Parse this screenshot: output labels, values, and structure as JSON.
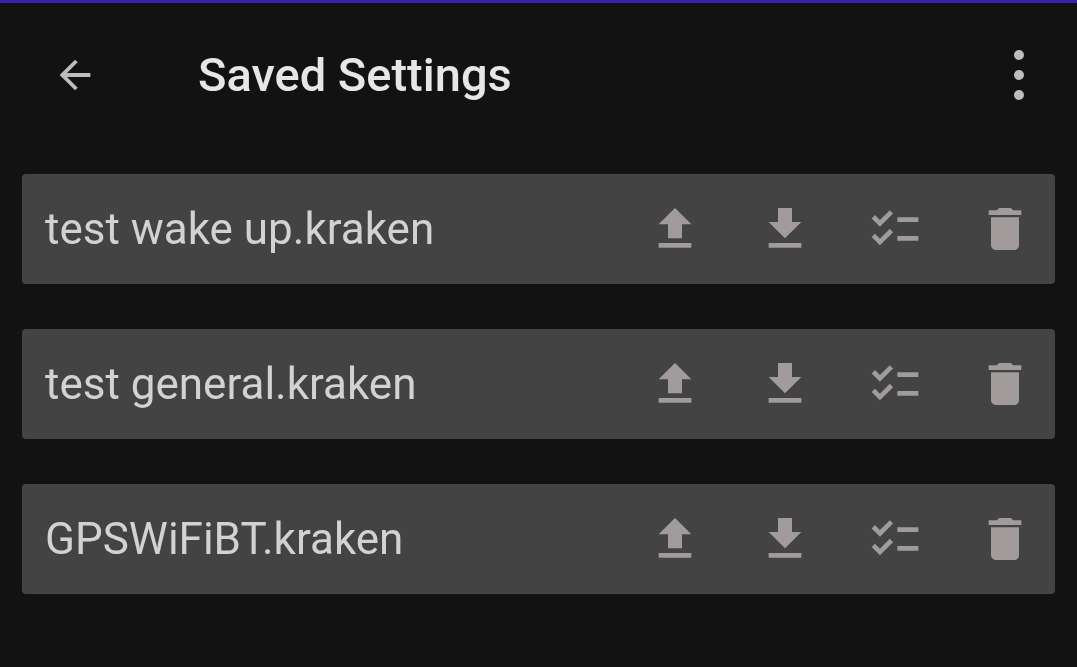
{
  "app_bar": {
    "title": "Saved Settings"
  },
  "saved_settings": [
    {
      "name": "test wake up.kraken"
    },
    {
      "name": "test general.kraken"
    },
    {
      "name": "GPSWiFiBT.kraken"
    }
  ]
}
